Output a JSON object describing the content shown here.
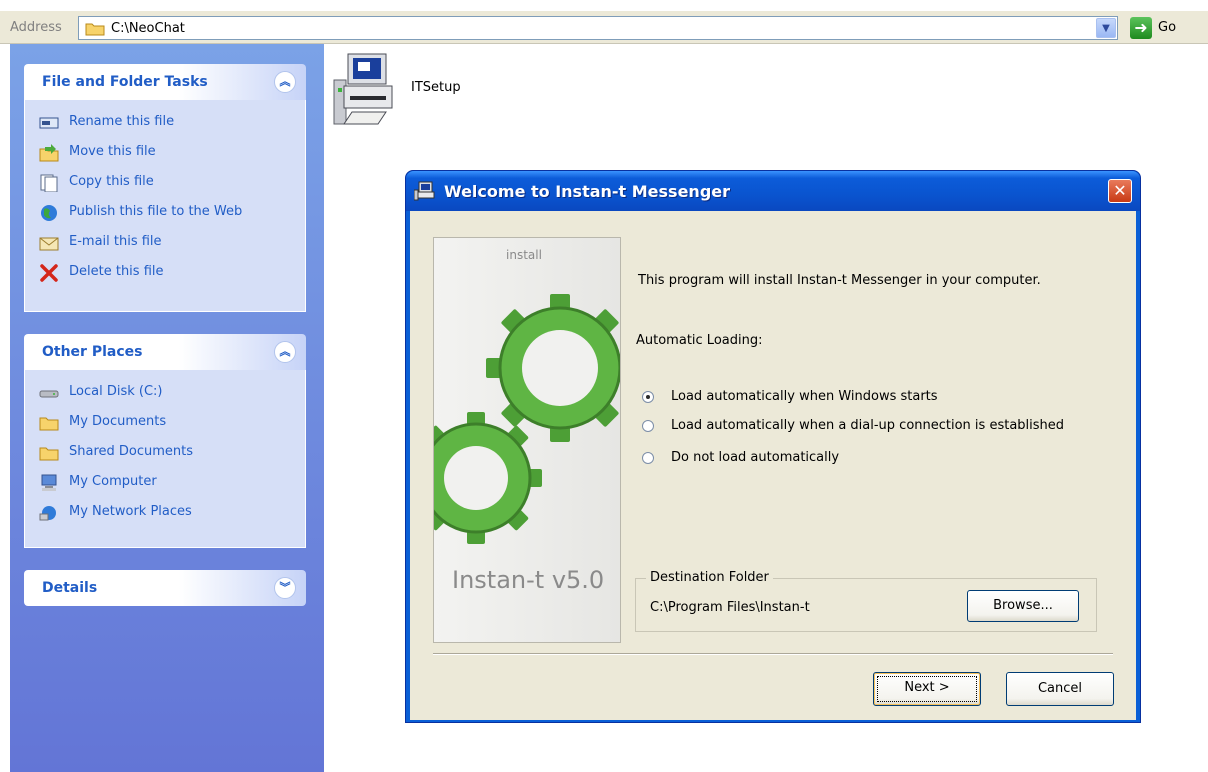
{
  "address_bar": {
    "label": "Address",
    "value": "C:\\NeoChat",
    "go_label": "Go"
  },
  "task_pane": {
    "file_tasks": {
      "title": "File and Folder Tasks",
      "items": [
        {
          "label": "Rename this file",
          "icon": "rename-icon"
        },
        {
          "label": "Move this file",
          "icon": "move-icon"
        },
        {
          "label": "Copy this file",
          "icon": "copy-icon"
        },
        {
          "label": "Publish this file to the Web",
          "icon": "globe-icon"
        },
        {
          "label": "E-mail this file",
          "icon": "email-icon"
        },
        {
          "label": "Delete this file",
          "icon": "delete-icon"
        }
      ]
    },
    "other_places": {
      "title": "Other Places",
      "items": [
        {
          "label": "Local Disk (C:)",
          "icon": "disk-icon"
        },
        {
          "label": "My Documents",
          "icon": "folder-icon"
        },
        {
          "label": "Shared Documents",
          "icon": "folder-icon"
        },
        {
          "label": "My Computer",
          "icon": "computer-icon"
        },
        {
          "label": "My Network Places",
          "icon": "network-icon"
        }
      ]
    },
    "details": {
      "title": "Details"
    }
  },
  "desktop": {
    "file_name": "ITSetup"
  },
  "dialog": {
    "title": "Welcome to Instan-t Messenger",
    "side_image": {
      "caption": "install",
      "version": "Instan-t v5.0"
    },
    "intro": "This program will install Instan-t Messenger in your computer.",
    "autoload_label": "Automatic Loading:",
    "options": [
      {
        "label": "Load automatically when Windows starts",
        "checked": true
      },
      {
        "label": "Load automatically when a dial-up connection is established",
        "checked": false
      },
      {
        "label": "Do not load automatically",
        "checked": false
      }
    ],
    "destination": {
      "legend": "Destination Folder",
      "path": "C:\\Program Files\\Instan-t",
      "browse_label": "Browse..."
    },
    "next_label": "Next >",
    "cancel_label": "Cancel"
  },
  "colors": {
    "title_blue": "#0a54cf",
    "task_link": "#215dc6",
    "dialog_face": "#ece9d8",
    "gear_green": "#3f9b2f"
  }
}
